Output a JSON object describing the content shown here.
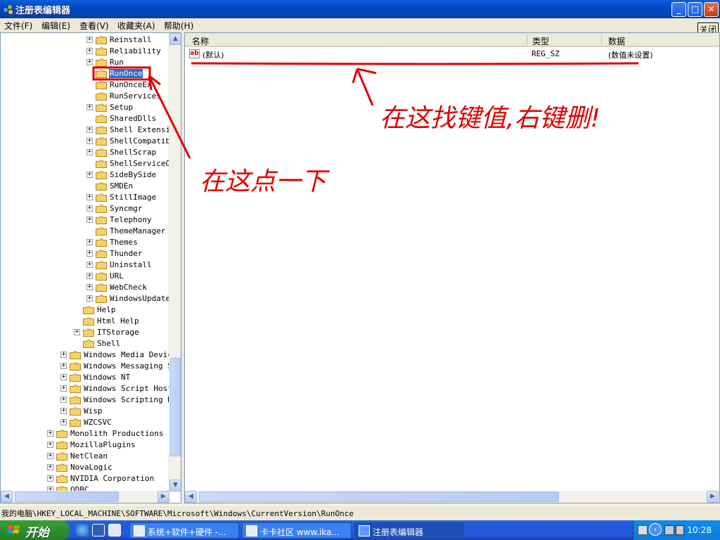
{
  "window": {
    "title": "注册表编辑器",
    "minimize": "_",
    "maximize": "□",
    "close": "✕"
  },
  "menu": {
    "file": "文件(F)",
    "edit": "编辑(E)",
    "view": "查看(V)",
    "favorites": "收藏夹(A)",
    "help": "帮助(H)",
    "close_tip": "关闭"
  },
  "tree": {
    "nodes": [
      {
        "label": "Reinstall",
        "expandable": true
      },
      {
        "label": "Reliability",
        "expandable": true
      },
      {
        "label": "Run",
        "expandable": true
      },
      {
        "label": "RunOnce",
        "expandable": false,
        "selected": true
      },
      {
        "label": "RunOnceEx",
        "expandable": false
      },
      {
        "label": "RunServices",
        "expandable": false
      },
      {
        "label": "Setup",
        "expandable": true
      },
      {
        "label": "SharedDlls",
        "expandable": false
      },
      {
        "label": "Shell Extensions",
        "expandable": true
      },
      {
        "label": "ShellCompatibility",
        "expandable": true
      },
      {
        "label": "ShellScrap",
        "expandable": true
      },
      {
        "label": "ShellServiceObjectDelayLoad",
        "expandable": false
      },
      {
        "label": "SideBySide",
        "expandable": true
      },
      {
        "label": "SMDEn",
        "expandable": false
      },
      {
        "label": "StillImage",
        "expandable": true
      },
      {
        "label": "Syncmgr",
        "expandable": true
      },
      {
        "label": "Telephony",
        "expandable": true
      },
      {
        "label": "ThemeManager",
        "expandable": false
      },
      {
        "label": "Themes",
        "expandable": true
      },
      {
        "label": "Thunder",
        "expandable": true
      },
      {
        "label": "Uninstall",
        "expandable": true
      },
      {
        "label": "URL",
        "expandable": true
      },
      {
        "label": "WebCheck",
        "expandable": true
      },
      {
        "label": "WindowsUpdate",
        "expandable": true
      }
    ],
    "level2": [
      {
        "label": "Help",
        "expandable": false
      },
      {
        "label": "Html Help",
        "expandable": false
      },
      {
        "label": "ITStorage",
        "expandable": true
      },
      {
        "label": "Shell",
        "expandable": false
      }
    ],
    "level1": [
      {
        "label": "Windows Media Device Manager",
        "expandable": true
      },
      {
        "label": "Windows Messaging Subsystem",
        "expandable": true
      },
      {
        "label": "Windows NT",
        "expandable": true
      },
      {
        "label": "Windows Script Host",
        "expandable": true
      },
      {
        "label": "Windows Scripting Host",
        "expandable": true
      },
      {
        "label": "Wisp",
        "expandable": true
      },
      {
        "label": "WZCSVC",
        "expandable": true
      }
    ],
    "level0": [
      {
        "label": "Monolith Productions",
        "expandable": true
      },
      {
        "label": "MozillaPlugins",
        "expandable": true
      },
      {
        "label": "NetClean",
        "expandable": true
      },
      {
        "label": "NovaLogic",
        "expandable": true
      },
      {
        "label": "NVIDIA Corporation",
        "expandable": true
      },
      {
        "label": "ODBC",
        "expandable": true
      }
    ]
  },
  "list": {
    "columns": {
      "name": "名称",
      "type": "类型",
      "data": "数据"
    },
    "rows": [
      {
        "icon": "ab",
        "name": "(默认)",
        "type": "REG_SZ",
        "data": "(数值未设置)"
      }
    ]
  },
  "status": "我的电脑\\HKEY_LOCAL_MACHINE\\SOFTWARE\\Microsoft\\Windows\\CurrentVersion\\RunOnce",
  "taskbar": {
    "start": "开始",
    "tasks": [
      {
        "label": "系统+软件+硬件 -...",
        "active": false
      },
      {
        "label": "卡卡社区 www.ika...",
        "active": false
      },
      {
        "label": "注册表编辑器",
        "active": true
      }
    ],
    "clock": "10:28"
  },
  "annotations": {
    "note_right": "在这找键值,右键删!",
    "note_left": "在这点一下"
  },
  "colors": {
    "annotation": "#e00000",
    "selection": "#316ac5",
    "titlebar": "#0348c7"
  }
}
